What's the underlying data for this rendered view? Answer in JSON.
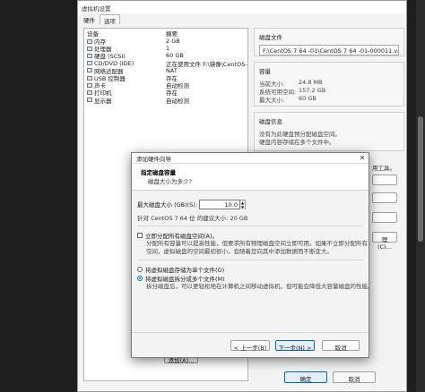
{
  "main_window": {
    "title": "虚拟机设置",
    "tabs": [
      "硬件",
      "选项"
    ],
    "device_header": {
      "device": "设备",
      "summary": "摘要"
    },
    "devices": [
      {
        "name": "内存",
        "summary": "2 GB",
        "icon": "memory-icon"
      },
      {
        "name": "处理器",
        "summary": "1",
        "icon": "processor-icon"
      },
      {
        "name": "硬盘 (SCSI)",
        "summary": "60 GB",
        "icon": "hard-disk-icon"
      },
      {
        "name": "CD/DVD (IDE)",
        "summary": "正在使用文件 F:\\镜像\\CentOS-...",
        "icon": "cd-dvd-icon"
      },
      {
        "name": "网络适配器",
        "summary": "NAT",
        "icon": "network-adapter-icon"
      },
      {
        "name": "USB 控制器",
        "summary": "存在",
        "icon": "usb-controller-icon"
      },
      {
        "name": "声卡",
        "summary": "自动检测",
        "icon": "sound-card-icon"
      },
      {
        "name": "打印机",
        "summary": "存在",
        "icon": "printer-icon"
      },
      {
        "name": "显示器",
        "summary": "自动检测",
        "icon": "display-icon"
      }
    ],
    "disk_file": {
      "title": "磁盘文件",
      "value": "F:\\CentOS 7 64 -01\\CentOS 7 64 -01-000011.vmdk"
    },
    "capacity": {
      "title": "容量",
      "rows": [
        {
          "label": "当前大小:",
          "value": "24.8 MB"
        },
        {
          "label": "系统可用空间:",
          "value": "157.2 GB"
        },
        {
          "label": "最大大小:",
          "value": "60 GB"
        }
      ]
    },
    "disk_info": {
      "title": "磁盘信息",
      "lines": [
        "没有为此硬盘预分配磁盘空间。",
        "硬盘内容存储在多个文件中。"
      ]
    },
    "clipped_texts": [
      "用工具。",
      "理(C)..."
    ],
    "add_button_partial": "添加(A)...",
    "bottom_buttons": {
      "ok": "确定",
      "cancel": "取消"
    }
  },
  "wizard": {
    "title": "添加硬件向导",
    "close_glyph": "✕",
    "header_title": "指定磁盘容量",
    "header_subtitle": "磁盘大小为多少?",
    "max_size_label": "最大磁盘大小 (GB)(S):",
    "max_size_value": "10.0",
    "spin_up": "▲",
    "spin_down": "▼",
    "recommended_text": "针对 CentOS 7 64 位 的建议大小: 20 GB",
    "allocate_now": {
      "label": "立即分配所有磁盘空间(A)。",
      "checked": false,
      "desc": [
        "分配所有容量可以提高性能，但要求所有物理磁盘空间立即可用。如果不立即分配所有",
        "空间，虚拟磁盘的空间最初很小，会随着您向其中添加数据而不断变大。"
      ]
    },
    "single_file": {
      "label": "将虚拟磁盘存储为单个文件(O)",
      "selected": false
    },
    "multiple_files": {
      "label": "将虚拟磁盘拆分成多个文件(M)",
      "selected": true,
      "desc": [
        "拆分磁盘后，可以更轻松地在计算机之间移动虚拟机，但可能会降低大容量磁盘的性能。"
      ]
    },
    "buttons": {
      "back": "< 上一步(B)",
      "next": "下一步(N) >",
      "cancel": "取消"
    }
  }
}
